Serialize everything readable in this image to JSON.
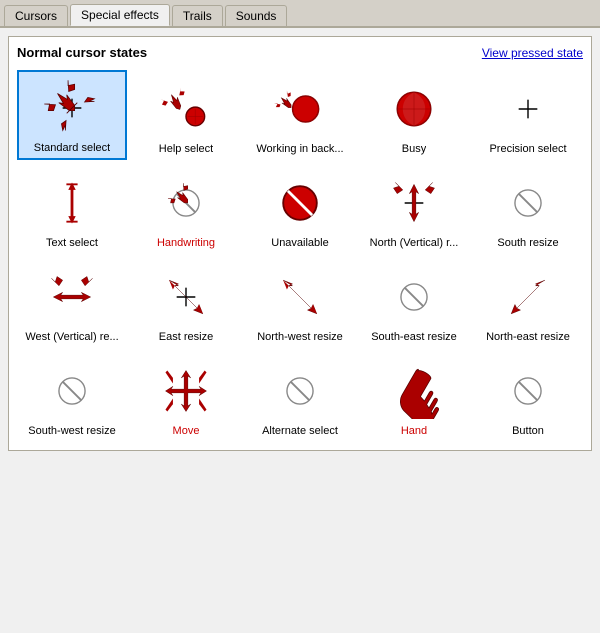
{
  "tabs": [
    {
      "id": "cursors",
      "label": "Cursors",
      "active": false
    },
    {
      "id": "special-effects",
      "label": "Special effects",
      "active": true
    },
    {
      "id": "trails",
      "label": "Trails",
      "active": false
    },
    {
      "id": "sounds",
      "label": "Sounds",
      "active": false
    }
  ],
  "panel": {
    "title": "Normal cursor states",
    "view_pressed_label": "View pressed state"
  },
  "cursors": [
    {
      "id": "standard-select",
      "label": "Standard select",
      "selected": true,
      "label_color": "normal",
      "icon": "standard-select"
    },
    {
      "id": "help-select",
      "label": "Help select",
      "selected": false,
      "label_color": "normal",
      "icon": "help-select"
    },
    {
      "id": "working-in-back",
      "label": "Working in back...",
      "selected": false,
      "label_color": "normal",
      "icon": "working-in-back"
    },
    {
      "id": "busy",
      "label": "Busy",
      "selected": false,
      "label_color": "normal",
      "icon": "busy"
    },
    {
      "id": "precision-select",
      "label": "Precision select",
      "selected": false,
      "label_color": "normal",
      "icon": "precision-select"
    },
    {
      "id": "text-select",
      "label": "Text select",
      "selected": false,
      "label_color": "normal",
      "icon": "text-select"
    },
    {
      "id": "handwriting",
      "label": "Handwriting",
      "selected": false,
      "label_color": "red",
      "icon": "handwriting"
    },
    {
      "id": "unavailable",
      "label": "Unavailable",
      "selected": false,
      "label_color": "normal",
      "icon": "unavailable"
    },
    {
      "id": "north-vertical",
      "label": "North (Vertical) r...",
      "selected": false,
      "label_color": "normal",
      "icon": "north-vertical"
    },
    {
      "id": "south-resize",
      "label": "South resize",
      "selected": false,
      "label_color": "normal",
      "icon": "south-resize"
    },
    {
      "id": "west-vertical",
      "label": "West (Vertical) re...",
      "selected": false,
      "label_color": "normal",
      "icon": "west-vertical"
    },
    {
      "id": "east-resize",
      "label": "East resize",
      "selected": false,
      "label_color": "normal",
      "icon": "east-resize"
    },
    {
      "id": "northwest-resize",
      "label": "North-west resize",
      "selected": false,
      "label_color": "normal",
      "icon": "northwest-resize"
    },
    {
      "id": "southeast-resize",
      "label": "South-east resize",
      "selected": false,
      "label_color": "normal",
      "icon": "southeast-resize"
    },
    {
      "id": "northeast-resize",
      "label": "North-east resize",
      "selected": false,
      "label_color": "normal",
      "icon": "northeast-resize"
    },
    {
      "id": "southwest-resize",
      "label": "South-west resize",
      "selected": false,
      "label_color": "normal",
      "icon": "southwest-resize"
    },
    {
      "id": "move",
      "label": "Move",
      "selected": false,
      "label_color": "red",
      "icon": "move"
    },
    {
      "id": "alternate-select",
      "label": "Alternate select",
      "selected": false,
      "label_color": "normal",
      "icon": "alternate-select"
    },
    {
      "id": "hand",
      "label": "Hand",
      "selected": false,
      "label_color": "red",
      "icon": "hand"
    },
    {
      "id": "button",
      "label": "Button",
      "selected": false,
      "label_color": "normal",
      "icon": "button"
    }
  ]
}
